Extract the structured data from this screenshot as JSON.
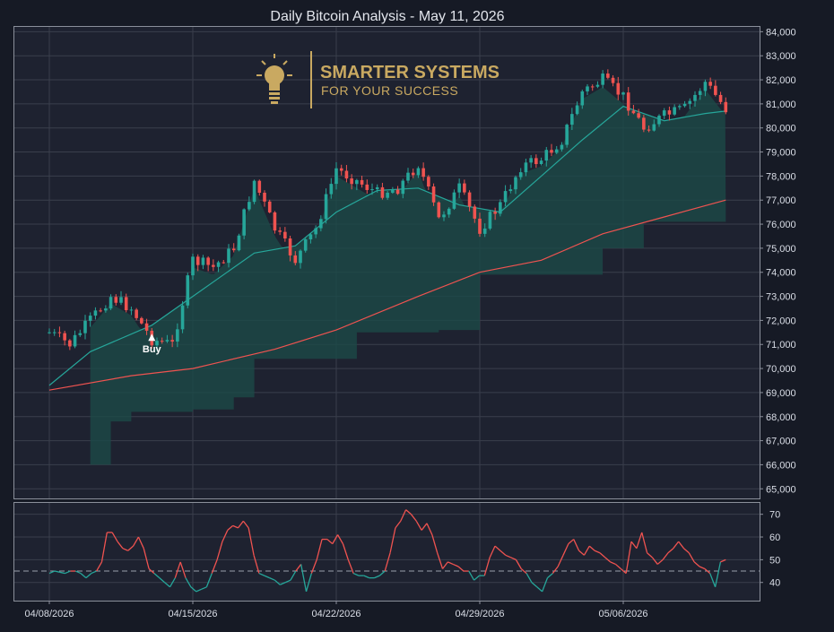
{
  "chart_data": {
    "type": "candlestick",
    "title": "Daily Bitcoin Analysis - May 11, 2026",
    "colors": {
      "background": "#161a25",
      "panel": "#1e2230",
      "grid": "#3a3f4c",
      "up": "#26a69a",
      "down": "#ef5350",
      "band_fill": "#1c4a47",
      "fast_ma": "#26a69a",
      "slow_ma": "#ef5350",
      "logo_gold": "#c9a961"
    },
    "logo": {
      "line1": "SMARTER SYSTEMS",
      "line2": "FOR YOUR SUCCESS",
      "icon": "lightbulb-icon"
    },
    "x_axis": {
      "tick_labels": [
        "04/08/2026",
        "04/15/2026",
        "04/22/2026",
        "04/29/2026",
        "05/06/2026"
      ],
      "start_date": "04/08/2026",
      "end_date": "05/11/2026"
    },
    "price_axis": {
      "ylim": [
        64600,
        84200
      ],
      "ticks": [
        65000,
        66000,
        67000,
        68000,
        69000,
        70000,
        71000,
        72000,
        73000,
        74000,
        75000,
        76000,
        77000,
        78000,
        79000,
        80000,
        81000,
        82000,
        83000,
        84000
      ],
      "tick_labels": [
        "65,000",
        "66,000",
        "67,000",
        "68,000",
        "69,000",
        "70,000",
        "71,000",
        "72,000",
        "73,000",
        "74,000",
        "75,000",
        "76,000",
        "77,000",
        "78,000",
        "79,000",
        "80,000",
        "81,000",
        "82,000",
        "83,000",
        "84,000"
      ]
    },
    "price_close_path": [
      [
        "04/08/2026",
        71500
      ],
      [
        "04/09/2026",
        71000
      ],
      [
        "04/10/2026",
        72000
      ],
      [
        "04/11/2026",
        73000
      ],
      [
        "04/12/2026",
        72500
      ],
      [
        "04/13/2026",
        71200
      ],
      [
        "04/14/2026",
        71000
      ],
      [
        "04/15/2026",
        74500
      ],
      [
        "04/16/2026",
        74200
      ],
      [
        "04/17/2026",
        75000
      ],
      [
        "04/18/2026",
        77800
      ],
      [
        "04/19/2026",
        75800
      ],
      [
        "04/20/2026",
        74500
      ],
      [
        "04/21/2026",
        75800
      ],
      [
        "04/22/2026",
        78300
      ],
      [
        "04/23/2026",
        77800
      ],
      [
        "04/24/2026",
        77300
      ],
      [
        "04/25/2026",
        77500
      ],
      [
        "04/26/2026",
        78500
      ],
      [
        "04/27/2026",
        76200
      ],
      [
        "04/28/2026",
        77500
      ],
      [
        "04/29/2026",
        75800
      ],
      [
        "04/30/2026",
        76800
      ],
      [
        "05/01/2026",
        78400
      ],
      [
        "05/02/2026",
        78700
      ],
      [
        "05/03/2026",
        79500
      ],
      [
        "05/04/2026",
        81500
      ],
      [
        "05/05/2026",
        82000
      ],
      [
        "05/06/2026",
        81300
      ],
      [
        "05/07/2026",
        80000
      ],
      [
        "05/08/2026",
        80500
      ],
      [
        "05/09/2026",
        80800
      ],
      [
        "05/10/2026",
        81900
      ],
      [
        "05/11/2026",
        80800
      ]
    ],
    "fast_ma_path": [
      [
        "04/08/2026",
        69300
      ],
      [
        "04/10/2026",
        70700
      ],
      [
        "04/13/2026",
        71800
      ],
      [
        "04/15/2026",
        73000
      ],
      [
        "04/18/2026",
        74800
      ],
      [
        "04/20/2026",
        75100
      ],
      [
        "04/22/2026",
        76500
      ],
      [
        "04/24/2026",
        77400
      ],
      [
        "04/26/2026",
        77500
      ],
      [
        "04/28/2026",
        76800
      ],
      [
        "04/30/2026",
        76500
      ],
      [
        "05/02/2026",
        78000
      ],
      [
        "05/04/2026",
        79500
      ],
      [
        "05/06/2026",
        80900
      ],
      [
        "05/08/2026",
        80300
      ],
      [
        "05/10/2026",
        80600
      ],
      [
        "05/11/2026",
        80700
      ]
    ],
    "slow_ma_path": [
      [
        "04/08/2026",
        69100
      ],
      [
        "04/12/2026",
        69700
      ],
      [
        "04/15/2026",
        70000
      ],
      [
        "04/19/2026",
        70800
      ],
      [
        "04/22/2026",
        71600
      ],
      [
        "04/26/2026",
        73000
      ],
      [
        "04/29/2026",
        74000
      ],
      [
        "05/02/2026",
        74500
      ],
      [
        "05/05/2026",
        75600
      ],
      [
        "05/08/2026",
        76300
      ],
      [
        "05/11/2026",
        77000
      ]
    ],
    "support_band_floor": [
      [
        "04/10/2026",
        66000
      ],
      [
        "04/11/2026",
        67800
      ],
      [
        "04/12/2026",
        68200
      ],
      [
        "04/15/2026",
        68300
      ],
      [
        "04/17/2026",
        68800
      ],
      [
        "04/18/2026",
        70400
      ],
      [
        "04/22/2026",
        70400
      ],
      [
        "04/23/2026",
        71500
      ],
      [
        "04/27/2026",
        71600
      ],
      [
        "04/29/2026",
        73900
      ],
      [
        "05/04/2026",
        73900
      ],
      [
        "05/05/2026",
        75000
      ],
      [
        "05/07/2026",
        76100
      ],
      [
        "05/11/2026",
        76500
      ]
    ],
    "annotations": [
      {
        "date": "04/13/2026",
        "price": 71300,
        "text": "Buy"
      }
    ],
    "oscillator": {
      "ylim": [
        32,
        75
      ],
      "ticks": [
        40,
        50,
        60,
        70
      ],
      "tick_labels": [
        "40",
        "50",
        "60",
        "70"
      ],
      "reference_level": 45,
      "values": [
        44,
        45,
        44.5,
        44,
        45,
        45,
        44,
        42,
        44,
        45,
        49,
        62,
        62,
        58,
        55,
        54,
        56,
        60,
        55,
        46,
        44,
        42,
        40,
        38,
        42,
        49,
        42,
        38,
        36,
        37,
        38,
        44,
        50,
        58,
        63,
        65,
        64,
        67,
        64,
        52,
        44,
        43,
        42,
        41,
        39,
        40,
        41,
        45,
        48,
        36,
        44,
        50,
        59,
        59,
        57,
        61,
        57,
        50,
        44,
        43,
        43,
        42,
        42,
        43,
        45,
        53,
        64,
        67,
        72,
        70,
        67,
        63,
        66,
        61,
        53,
        46,
        49,
        48,
        47,
        45,
        45,
        41,
        43,
        43,
        51,
        56,
        54,
        52,
        51,
        50,
        46,
        44,
        40,
        38,
        36,
        42,
        44,
        47,
        52,
        57,
        59,
        54,
        52,
        56,
        54,
        53,
        51,
        49,
        48,
        46,
        44,
        58,
        55,
        62,
        53,
        51,
        48,
        50,
        53,
        55,
        58,
        55,
        53,
        49,
        47,
        46,
        44,
        38,
        49,
        50
      ]
    }
  }
}
